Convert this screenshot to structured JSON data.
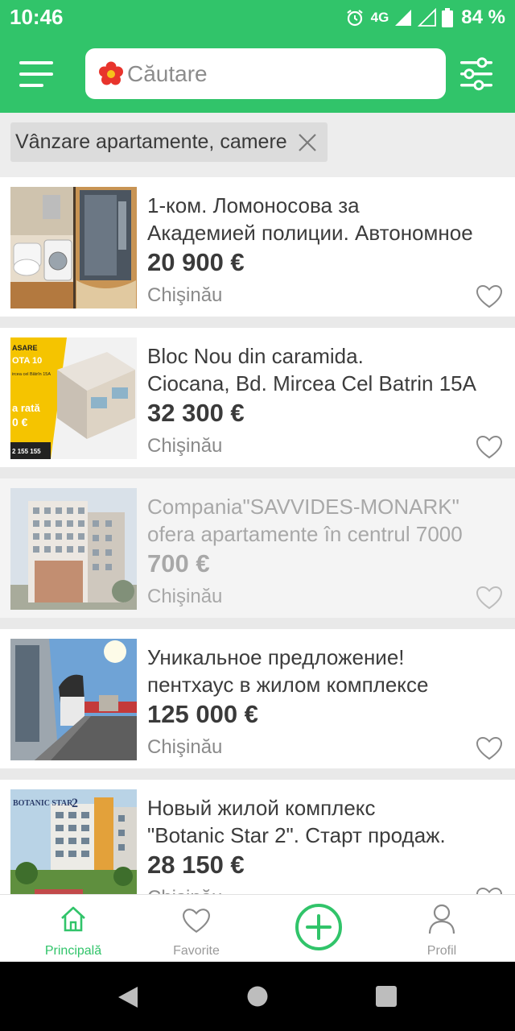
{
  "status_bar": {
    "time": "10:46",
    "network": "4G",
    "battery": "84 %"
  },
  "app_bar": {
    "search_placeholder": "Căutare"
  },
  "filter_chip": {
    "label": "Vânzare apartamente, camere"
  },
  "listings": [
    {
      "title_line1": "1-ком. Ломоносова за",
      "title_line2": "Академией полиции. Автономное",
      "price": "20 900 €",
      "city": "Chişinău",
      "dimmed": false
    },
    {
      "title_line1": "Bloc Nou din caramida.",
      "title_line2": "Ciocana, Bd. Mircea Cel Batrin 15A",
      "price": "32 300 €",
      "city": "Chişinău",
      "dimmed": false
    },
    {
      "title_line1": "Compania\"SAVVIDES-MONARK\"",
      "title_line2": "ofera apartamente în centrul 7000",
      "price": "700 €",
      "city": "Chişinău",
      "dimmed": true
    },
    {
      "title_line1": "Уникальное предложение!",
      "title_line2": "пентхаус в жилом комплексе",
      "price": "125 000 €",
      "city": "Chişinău",
      "dimmed": false
    },
    {
      "title_line1": "Новый жилой комплекс",
      "title_line2": "\"Botanic Star 2\". Старт продаж.",
      "price": "28 150 €",
      "city": "Chişinău",
      "dimmed": false
    }
  ],
  "thumb_text": {
    "promo_top": "ASARE",
    "promo_mid": "OTA 10",
    "promo_rata": "a rată",
    "promo_euro": "0 €",
    "promo_phone": "2 155 155",
    "promo_addr": "ircea cel Bătrîn 15A",
    "botanic_logo": "BOTANIC STAR",
    "botanic_num": "2"
  },
  "bottom_nav": {
    "home_label": "Principală",
    "favorites_label": "Favorite",
    "profile_label": "Profil"
  },
  "colors": {
    "brand_green": "#31c46a",
    "muted_text": "#8a8a8a"
  }
}
